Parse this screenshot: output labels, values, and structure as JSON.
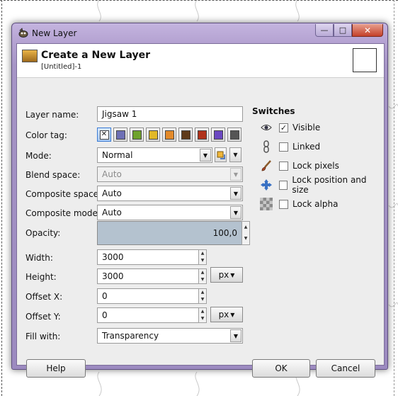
{
  "window": {
    "title": "New Layer"
  },
  "header": {
    "title": "Create a New Layer",
    "subtitle": "[Untitled]-1"
  },
  "form": {
    "layer_name_label": "Layer name:",
    "layer_name_value": "Jigsaw 1",
    "color_tag_label": "Color tag:",
    "color_tags": [
      {
        "name": "none",
        "color": "#ffffff"
      },
      {
        "name": "blue",
        "color": "#6d6fb5"
      },
      {
        "name": "green",
        "color": "#6ea22c"
      },
      {
        "name": "yellow",
        "color": "#e1b827"
      },
      {
        "name": "orange",
        "color": "#e38a2a"
      },
      {
        "name": "brown",
        "color": "#5e3a1a"
      },
      {
        "name": "red",
        "color": "#b0321b"
      },
      {
        "name": "violet",
        "color": "#6b48c1"
      },
      {
        "name": "gray",
        "color": "#555555"
      }
    ],
    "mode_label": "Mode:",
    "mode_value": "Normal",
    "blend_space_label": "Blend space:",
    "blend_space_value": "Auto",
    "composite_space_label": "Composite space:",
    "composite_space_value": "Auto",
    "composite_mode_label": "Composite mode:",
    "composite_mode_value": "Auto",
    "opacity_label": "Opacity:",
    "opacity_value": "100,0",
    "width_label": "Width:",
    "width_value": "3000",
    "height_label": "Height:",
    "height_value": "3000",
    "size_unit": "px",
    "offset_x_label": "Offset X:",
    "offset_x_value": "0",
    "offset_y_label": "Offset Y:",
    "offset_y_value": "0",
    "offset_unit": "px",
    "fill_label": "Fill with:",
    "fill_value": "Transparency"
  },
  "switches": {
    "title": "Switches",
    "items": [
      {
        "label": "Visible",
        "checked": true,
        "icon": "eye-icon"
      },
      {
        "label": "Linked",
        "checked": false,
        "icon": "chain-icon"
      },
      {
        "label": "Lock pixels",
        "checked": false,
        "icon": "brush-icon"
      },
      {
        "label": "Lock position and size",
        "checked": false,
        "icon": "move-icon"
      },
      {
        "label": "Lock alpha",
        "checked": false,
        "icon": "checkerboard-icon"
      }
    ]
  },
  "buttons": {
    "help": "Help",
    "ok": "OK",
    "cancel": "Cancel"
  },
  "colors": {
    "titlebar": "#b6a4d3",
    "close_button": "#c5402a",
    "dialog_bg": "#ededed",
    "opacity_fill": "#b4c2cf"
  }
}
